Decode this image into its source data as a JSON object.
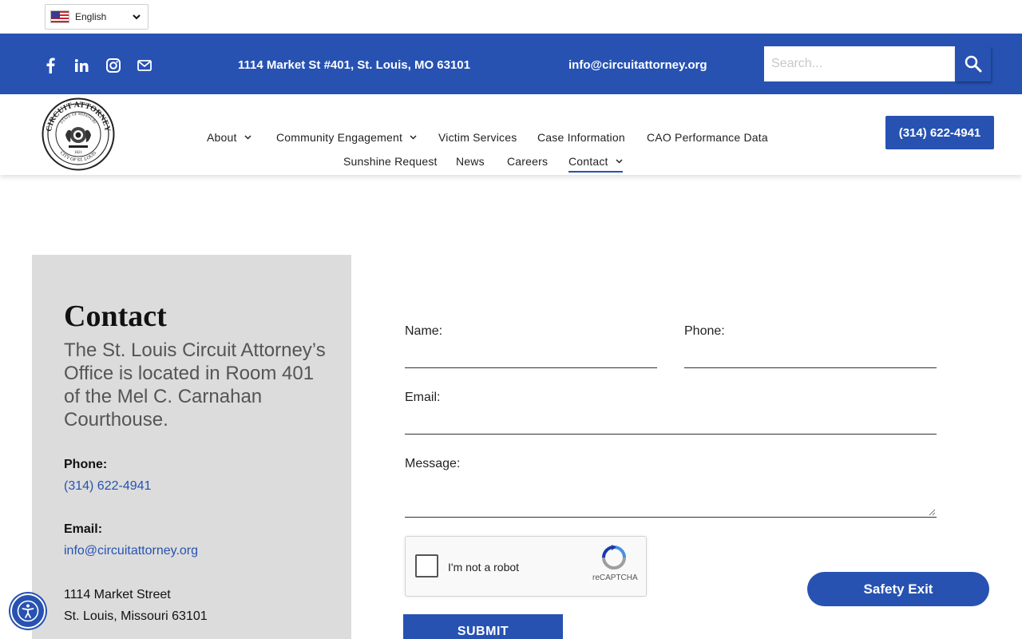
{
  "language": {
    "selected": "English"
  },
  "topbar": {
    "social_icons": [
      "facebook-icon",
      "linkedin-icon",
      "instagram-icon",
      "mail-icon"
    ],
    "address": "1114 Market St #401,  St. Louis, MO 63101",
    "email": "info@circuitattorney.org",
    "search_placeholder": "Search..."
  },
  "header": {
    "logo_text": {
      "top": "CIRCUIT ATTORNEY",
      "inner": "STATE OF MISSOURI",
      "year": "1821",
      "bottom": "CITY OF ST. LOUIS"
    },
    "nav_row1": [
      "About",
      "Community Engagement",
      "Victim Services",
      "Case Information",
      "CAO Performance Data"
    ],
    "nav_row2": [
      "Sunshine Request",
      "News",
      "Careers",
      "Contact"
    ],
    "phone_button": "(314) 622-4941"
  },
  "contact_panel": {
    "title": "Contact",
    "description": "The St. Louis Circuit Attorney’s Office is located in Room 401 of the Mel C. Carnahan Courthouse.",
    "phone_label": "Phone:",
    "phone": "(314) 622-4941",
    "email_label": "Email:",
    "email": "info@circuitattorney.org",
    "address_line1": "1114 Market Street",
    "address_line2": "St. Louis, Missouri 63101"
  },
  "form": {
    "name_label": "Name:",
    "phone_label": "Phone:",
    "email_label": "Email:",
    "message_label": "Message:",
    "captcha_label": "I'm not a robot",
    "captcha_brand": "reCAPTCHA",
    "submit": "SUBMIT"
  },
  "safety_exit": "Safety Exit",
  "colors": {
    "brand_blue": "#2752b2",
    "panel_gray": "#dcdcdc"
  }
}
